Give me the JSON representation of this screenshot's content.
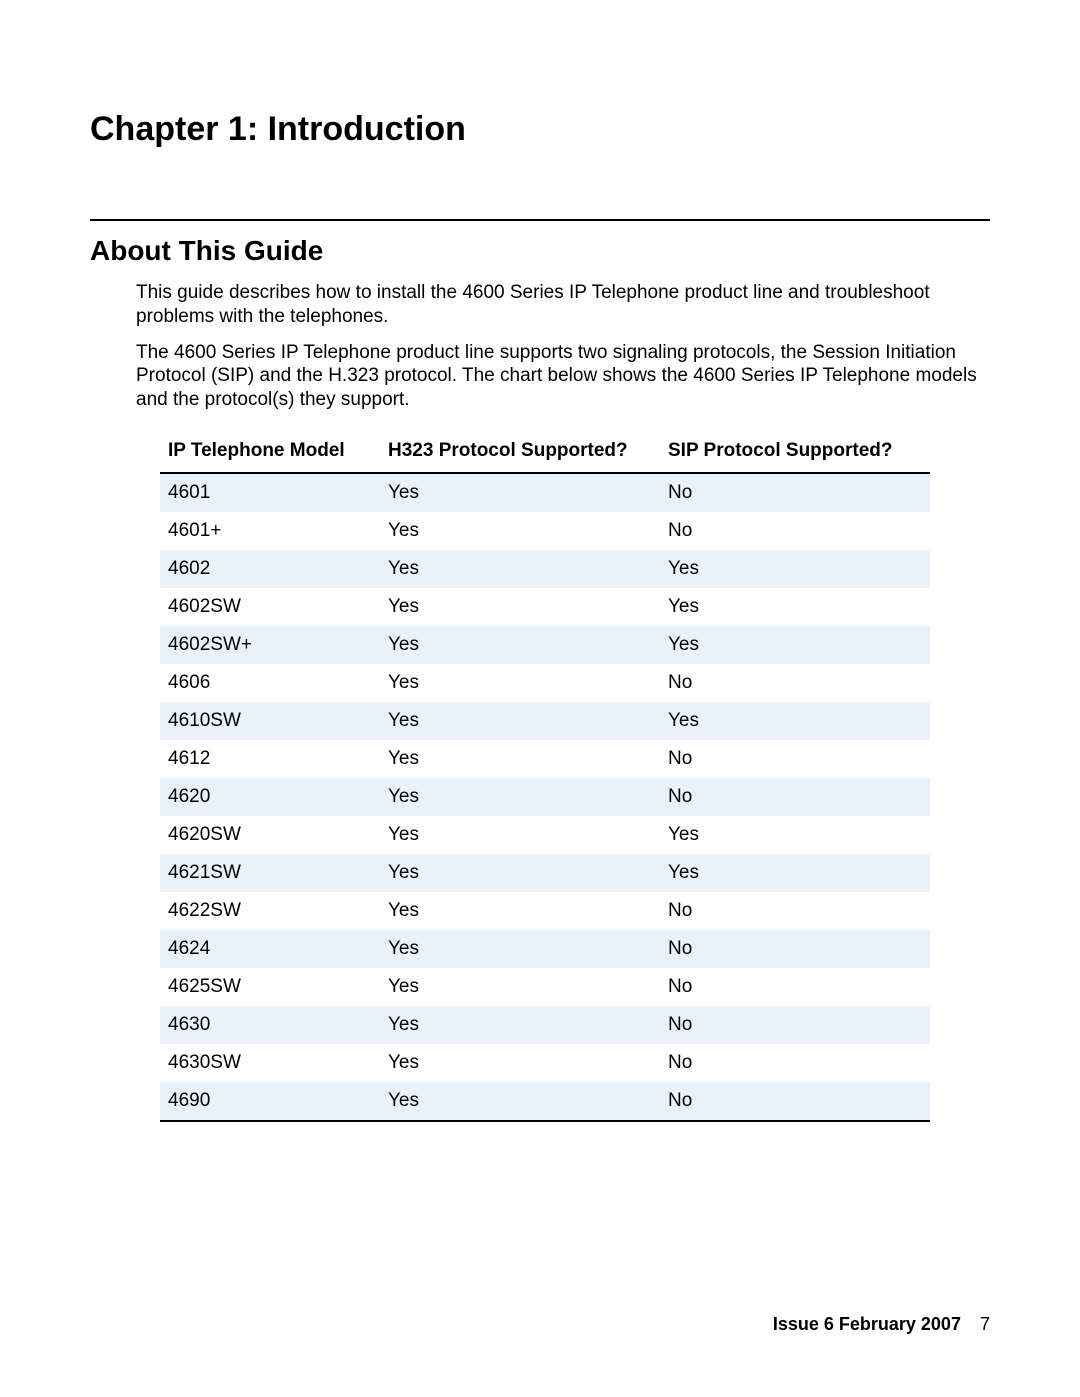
{
  "chapter_title": "Chapter 1:  Introduction",
  "section_title": "About This Guide",
  "paragraphs": [
    "This guide describes how to install the 4600 Series IP Telephone product line and troubleshoot problems with the telephones.",
    "The 4600 Series IP Telephone product line supports two signaling protocols, the Session Initiation Protocol (SIP) and the H.323 protocol. The chart below shows the 4600 Series IP Telephone models and the protocol(s) they support."
  ],
  "table": {
    "headers": {
      "model": "IP Telephone Model",
      "h323": "H323 Protocol Supported?",
      "sip": "SIP Protocol Supported?"
    },
    "rows": [
      {
        "model": "4601",
        "h323": "Yes",
        "sip": "No"
      },
      {
        "model": "4601+",
        "h323": "Yes",
        "sip": "No"
      },
      {
        "model": "4602",
        "h323": "Yes",
        "sip": "Yes"
      },
      {
        "model": "4602SW",
        "h323": "Yes",
        "sip": "Yes"
      },
      {
        "model": "4602SW+",
        "h323": "Yes",
        "sip": "Yes"
      },
      {
        "model": "4606",
        "h323": "Yes",
        "sip": "No"
      },
      {
        "model": "4610SW",
        "h323": "Yes",
        "sip": "Yes"
      },
      {
        "model": "4612",
        "h323": "Yes",
        "sip": "No"
      },
      {
        "model": "4620",
        "h323": "Yes",
        "sip": "No"
      },
      {
        "model": "4620SW",
        "h323": "Yes",
        "sip": "Yes"
      },
      {
        "model": "4621SW",
        "h323": "Yes",
        "sip": "Yes"
      },
      {
        "model": "4622SW",
        "h323": "Yes",
        "sip": "No"
      },
      {
        "model": "4624",
        "h323": "Yes",
        "sip": "No"
      },
      {
        "model": "4625SW",
        "h323": "Yes",
        "sip": "No"
      },
      {
        "model": "4630",
        "h323": "Yes",
        "sip": "No"
      },
      {
        "model": "4630SW",
        "h323": "Yes",
        "sip": "No"
      },
      {
        "model": "4690",
        "h323": "Yes",
        "sip": "No"
      }
    ]
  },
  "footer": {
    "issue": "Issue 6   February 2007",
    "page": "7"
  }
}
